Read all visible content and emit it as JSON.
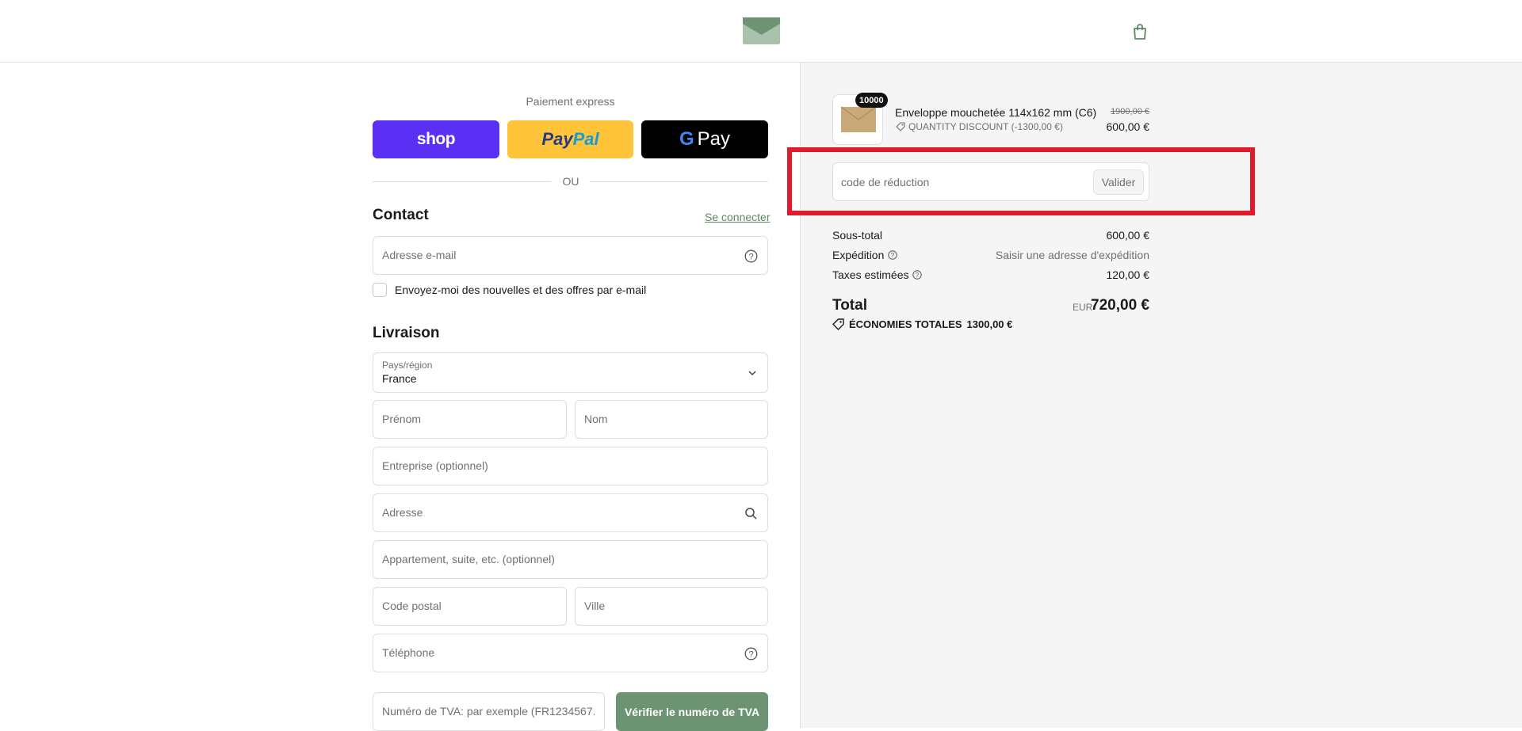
{
  "header": {
    "logo_icon": "envelope-logo-icon",
    "cart_icon": "shopping-bag-icon"
  },
  "express": {
    "title": "Paiement express",
    "shop_label": "shop",
    "paypal_label_1": "Pay",
    "paypal_label_2": "Pal",
    "gpay_label": "Pay",
    "gpay_g": "G",
    "or_label": "OU"
  },
  "contact": {
    "heading": "Contact",
    "login_link": "Se connecter",
    "email_placeholder": "Adresse e-mail",
    "newsletter_label": "Envoyez-moi des nouvelles et des offres par e-mail"
  },
  "delivery": {
    "heading": "Livraison",
    "country_label": "Pays/région",
    "country_value": "France",
    "first_name_placeholder": "Prénom",
    "last_name_placeholder": "Nom",
    "company_placeholder": "Entreprise (optionnel)",
    "address_placeholder": "Adresse",
    "apartment_placeholder": "Appartement, suite, etc. (optionnel)",
    "postal_placeholder": "Code postal",
    "city_placeholder": "Ville",
    "phone_placeholder": "Téléphone",
    "vat_placeholder": "Numéro de TVA: par exemple (FR1234567...",
    "vat_button": "Vérifier le numéro de TVA"
  },
  "summary": {
    "item": {
      "quantity": "10000",
      "name": "Enveloppe mouchetée 114x162 mm (C6)",
      "discount": "QUANTITY DISCOUNT (-1300,00 €)",
      "old_price": "1900,00 €",
      "price": "600,00 €"
    },
    "discount_code_placeholder": "code de réduction",
    "apply_button": "Valider",
    "subtotal_label": "Sous-total",
    "subtotal_value": "600,00 €",
    "shipping_label": "Expédition",
    "shipping_value": "Saisir une adresse d'expédition",
    "taxes_label": "Taxes estimées",
    "taxes_value": "120,00 €",
    "total_label": "Total",
    "currency": "EUR",
    "total_value": "720,00 €",
    "savings_label": "ÉCONOMIES TOTALES",
    "savings_value": "1300,00 €"
  },
  "colors": {
    "accent": "#6d9472",
    "shop": "#5a31f4",
    "paypal": "#ffc439",
    "highlight": "#e01a2a"
  }
}
